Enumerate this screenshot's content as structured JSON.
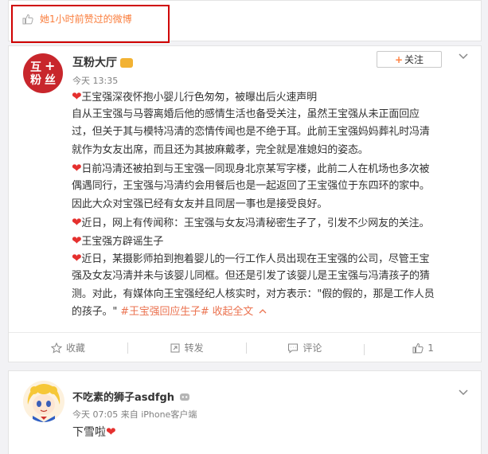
{
  "liked": {
    "text": "她1小时前赞过的微博"
  },
  "post1": {
    "author": "互粉大厅",
    "avatar": {
      "lines": [
        "互",
        "粉",
        "丝"
      ]
    },
    "time": "今天 13:35",
    "follow_label": "关注",
    "content": {
      "l1": "王宝强深夜怀抱小婴儿行色匆匆，被曝出后火速声明",
      "l2": "自从王宝强与马蓉离婚后他的感情生活也备受关注，虽然王宝强从未正面回应",
      "l3": "过，但关于其与模特冯清的恋情传闻也是不绝于耳。此前王宝强妈妈葬礼时冯清",
      "l4": "就作为女友出席，而且还为其披麻戴孝，完全就是准媳妇的姿态。",
      "l5": "日前冯清还被拍到与王宝强一同现身北京某写字楼，此前二人在机场也多次被",
      "l6": "偶遇同行，王宝强与冯清约会用餐后也是一起返回了王宝强位于东四环的家中。",
      "l7": "因此大众对宝强已经有女友并且同居一事也是接受良好。",
      "l8": "近日，网上有传闻称：王宝强与女友冯清秘密生子了，引发不少网友的关注。",
      "l9": "王宝强方辟谣生子",
      "l10": "近日，某摄影师拍到抱着婴儿的一行工作人员出现在王宝强的公司，尽管王宝",
      "l11": "强及女友冯清并未与该婴儿同框。但还是引发了该婴儿是王宝强与冯清孩子的猜",
      "l12": "测。对此，有媒体向王宝强经纪人核实时，对方表示：\"假的假的，那是工作人员",
      "l13_text": "的孩子。\"",
      "hashtag": "#王宝强回应生子#",
      "collapse": "收起全文"
    },
    "actions": {
      "favorite": "收藏",
      "repost": "转发",
      "comment": "评论",
      "like_count": "1"
    }
  },
  "post2": {
    "author": "不吃素的狮子asdfgh",
    "time_source": "今天 07:05 来自 iPhone客户端",
    "text": "下雪啦"
  },
  "colors": {
    "accent": "#eb7350",
    "heart": "#e5302e",
    "highlight_box": "#d00000"
  }
}
